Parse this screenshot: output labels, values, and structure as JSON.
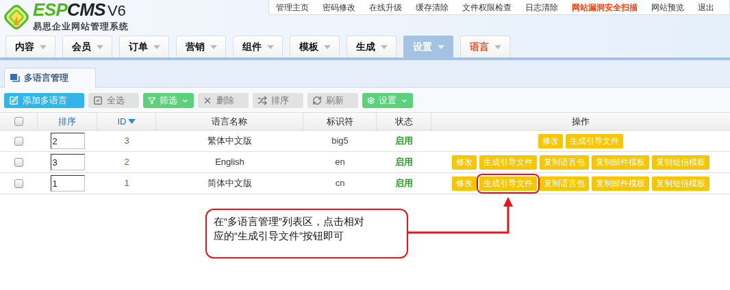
{
  "logo": {
    "brand_green": "ESP",
    "brand_dark": "CMS",
    "version": "V6",
    "subtitle": "易思企业网站管理系统"
  },
  "top_links": [
    {
      "label": "管理主页",
      "alert": false
    },
    {
      "label": "密码修改",
      "alert": false
    },
    {
      "label": "在线升级",
      "alert": false
    },
    {
      "label": "缓存清除",
      "alert": false
    },
    {
      "label": "文件权限检查",
      "alert": false
    },
    {
      "label": "日志清除",
      "alert": false
    },
    {
      "label": "网站漏洞安全扫描",
      "alert": true
    },
    {
      "label": "网站预览",
      "alert": false
    },
    {
      "label": "退出",
      "alert": false
    }
  ],
  "nav": [
    {
      "label": "内容",
      "selected": false,
      "alert": false
    },
    {
      "label": "会员",
      "selected": false,
      "alert": false
    },
    {
      "label": "订单",
      "selected": false,
      "alert": false
    },
    {
      "label": "营销",
      "selected": false,
      "alert": false
    },
    {
      "label": "组件",
      "selected": false,
      "alert": false
    },
    {
      "label": "模板",
      "selected": false,
      "alert": false
    },
    {
      "label": "生成",
      "selected": false,
      "alert": false
    },
    {
      "label": "设置",
      "selected": true,
      "alert": false
    },
    {
      "label": "语言",
      "selected": false,
      "alert": true
    }
  ],
  "page_tab": {
    "label": "多语言管理"
  },
  "toolbar": [
    {
      "label": "添加多语言",
      "kind": "primary",
      "dropdown": false
    },
    {
      "label": "全选",
      "kind": "muted",
      "dropdown": false
    },
    {
      "label": "筛选",
      "kind": "success",
      "dropdown": true
    },
    {
      "label": "删除",
      "kind": "muted",
      "dropdown": false
    },
    {
      "label": "排序",
      "kind": "muted",
      "dropdown": false
    },
    {
      "label": "刷新",
      "kind": "muted",
      "dropdown": false
    },
    {
      "label": "设置",
      "kind": "success",
      "dropdown": true
    }
  ],
  "table": {
    "select_all": {
      "checked": false
    },
    "columns": [
      {
        "label": "排序",
        "link": true,
        "sorted": false
      },
      {
        "label": "ID",
        "link": true,
        "sorted": true
      },
      {
        "label": "语言名称",
        "link": false,
        "sorted": false
      },
      {
        "label": "标识符",
        "link": false,
        "sorted": false
      },
      {
        "label": "状态",
        "link": false,
        "sorted": false
      },
      {
        "label": "操作",
        "link": false,
        "sorted": false
      }
    ],
    "rows": [
      {
        "checked": false,
        "order": "2",
        "id": "3",
        "name": "繁体中文版",
        "code": "big5",
        "status": "启用",
        "actions": [
          {
            "label": "修改",
            "highlighted": false
          },
          {
            "label": "生成引导文件",
            "highlighted": false
          }
        ]
      },
      {
        "checked": false,
        "order": "3",
        "id": "2",
        "name": "English",
        "code": "en",
        "status": "启用",
        "actions": [
          {
            "label": "修改",
            "highlighted": false
          },
          {
            "label": "生成引导文件",
            "highlighted": false
          },
          {
            "label": "复制语言包",
            "highlighted": false
          },
          {
            "label": "复制邮件模板",
            "highlighted": false
          },
          {
            "label": "复制短信模板",
            "highlighted": false
          }
        ]
      },
      {
        "checked": false,
        "order": "1",
        "id": "1",
        "name": "简体中文版",
        "code": "cn",
        "status": "启用",
        "actions": [
          {
            "label": "修改",
            "highlighted": false
          },
          {
            "label": "生成引导文件",
            "highlighted": true
          },
          {
            "label": "复制语言包",
            "highlighted": false
          },
          {
            "label": "复制邮件模板",
            "highlighted": false
          },
          {
            "label": "复制短信模板",
            "highlighted": false
          }
        ]
      }
    ]
  },
  "annotation": {
    "lines": [
      "在“多语言管理”列表区，点击相对",
      "应的“生成引导文件”按钮即可"
    ]
  }
}
